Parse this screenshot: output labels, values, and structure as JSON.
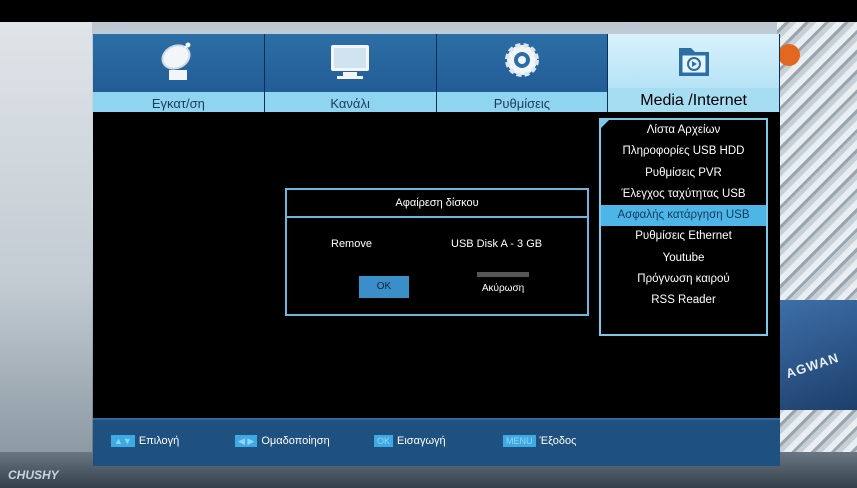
{
  "tabs": [
    {
      "label": "Εγκατ/ση",
      "icon": "satellite-dish-icon"
    },
    {
      "label": "Κανάλι",
      "icon": "tv-icon"
    },
    {
      "label": "Ρυθμίσεις",
      "icon": "gear-icon"
    },
    {
      "label": "Media /Internet",
      "icon": "media-folder-icon",
      "active": true
    }
  ],
  "menu": {
    "items": [
      "Λίστα Αρχείων",
      "Πληροφορίες USB HDD",
      "Ρυθμίσεις PVR",
      "Έλεγχος ταχύτητας USB",
      "Ασφαλής κατάργηση USB",
      "Ρυθμίσεις Ethernet",
      "Youtube",
      "Πρόγνωση καιρού",
      "RSS Reader"
    ],
    "selected_index": 4
  },
  "dialog": {
    "title": "Αφαίρεση δίσκου",
    "field_label": "Remove",
    "field_value": "USB Disk A - 3 GB",
    "ok_label": "OK",
    "cancel_label": "Ακύρωση"
  },
  "footer": {
    "hints": [
      {
        "key": "▲▼",
        "text": "Επιλογή"
      },
      {
        "key": "◀ ▶",
        "text": "Ομαδοποίηση"
      },
      {
        "key": "OK",
        "text": "Εισαγωγή"
      },
      {
        "key": "MENU",
        "text": "Έξοδος"
      }
    ]
  },
  "background": {
    "banner_text": "AGWAN",
    "watermark": "CHUSHY"
  },
  "colors": {
    "accent": "#4eb6e6",
    "tab_blue": "#1f5690",
    "footer_blue": "#1e5080"
  }
}
